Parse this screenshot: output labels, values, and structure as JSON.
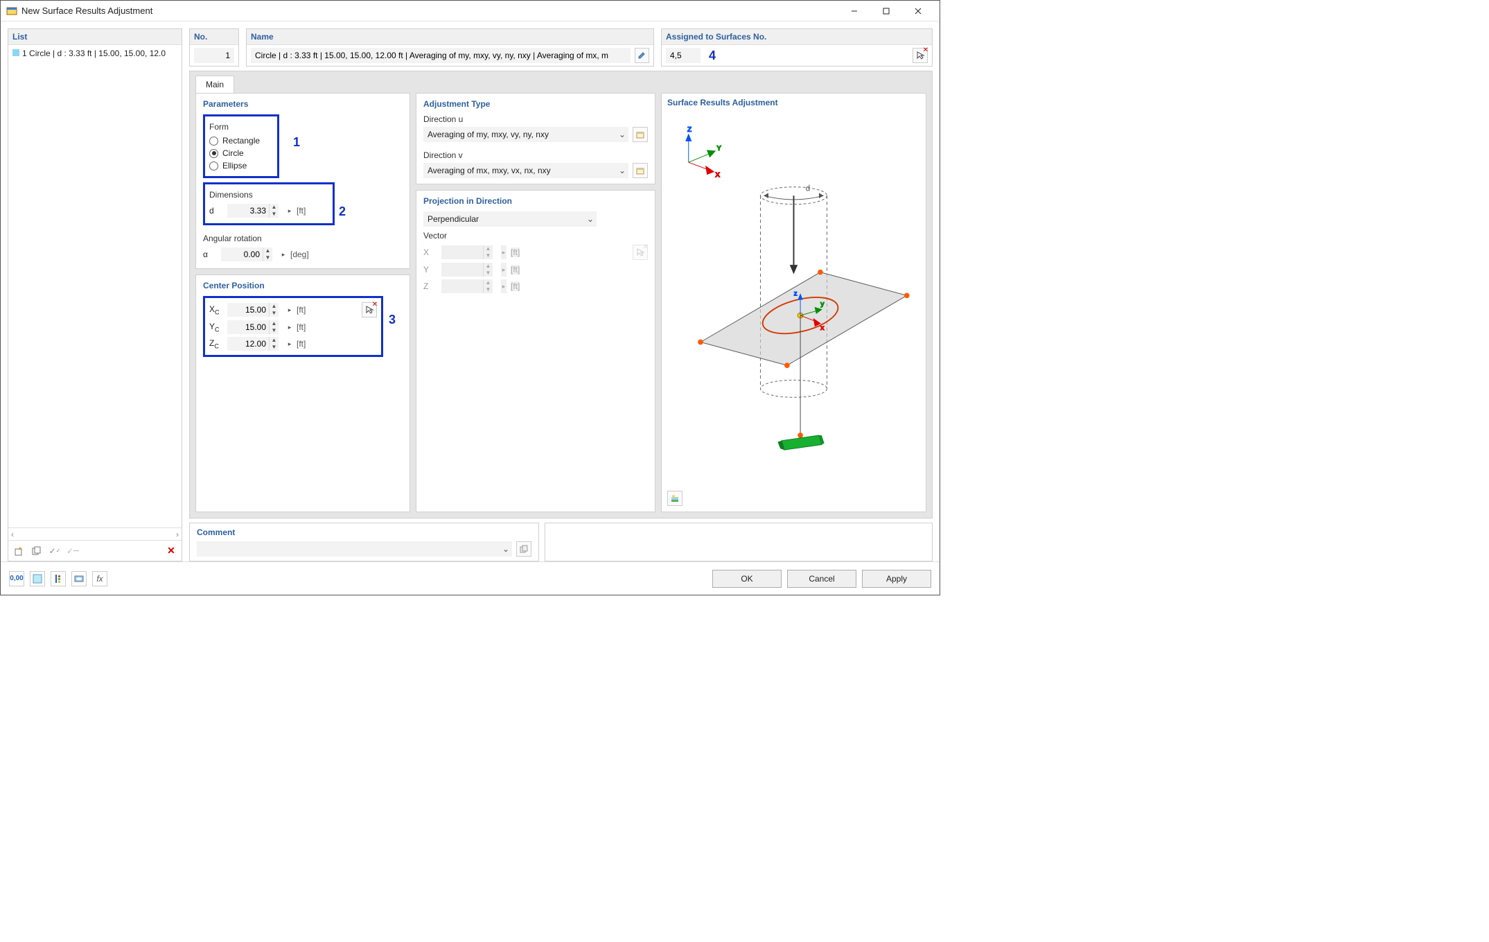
{
  "window": {
    "title": "New Surface Results Adjustment"
  },
  "list": {
    "header": "List",
    "items": [
      {
        "index": "1",
        "text": "Circle | d : 3.33 ft | 15.00, 15.00, 12.0"
      }
    ]
  },
  "headerRow": {
    "no": {
      "label": "No.",
      "value": "1"
    },
    "name": {
      "label": "Name",
      "value": "Circle | d : 3.33 ft | 15.00, 15.00, 12.00 ft | Averaging of my, mxy, vy, ny, nxy | Averaging of mx, m"
    },
    "assigned": {
      "label": "Assigned to Surfaces No.",
      "value": "4,5"
    }
  },
  "annotations": {
    "form": "1",
    "dimensions": "2",
    "center": "3",
    "assigned": "4"
  },
  "tabs": {
    "main": "Main"
  },
  "parameters": {
    "title": "Parameters",
    "form": {
      "label": "Form",
      "rectangle": "Rectangle",
      "circle": "Circle",
      "ellipse": "Ellipse",
      "selected": "circle"
    },
    "dimensions": {
      "label": "Dimensions",
      "d_label": "d",
      "d_value": "3.33",
      "d_unit": "[ft]"
    },
    "rotation": {
      "label": "Angular rotation",
      "a_label": "α",
      "a_value": "0.00",
      "a_unit": "[deg]"
    }
  },
  "center": {
    "title": "Center Position",
    "xc_label": "Xc",
    "xc_value": "15.00",
    "xc_unit": "[ft]",
    "yc_label": "Yc",
    "yc_value": "15.00",
    "yc_unit": "[ft]",
    "zc_label": "Zc",
    "zc_value": "12.00",
    "zc_unit": "[ft]"
  },
  "adj": {
    "title": "Adjustment Type",
    "u_label": "Direction u",
    "u_value": "Averaging of my, mxy, vy, ny, nxy",
    "v_label": "Direction v",
    "v_value": "Averaging of mx, mxy, vx, nx, nxy"
  },
  "proj": {
    "title": "Projection in Direction",
    "value": "Perpendicular",
    "vector": {
      "label": "Vector",
      "x_label": "X",
      "y_label": "Y",
      "z_label": "Z",
      "unit": "[ft]"
    }
  },
  "preview": {
    "title": "Surface Results Adjustment",
    "axes": {
      "z": "Z",
      "y": "Y",
      "x": "X",
      "sz": "z",
      "sy": "y",
      "sx": "x"
    },
    "d": "d"
  },
  "comment": {
    "title": "Comment"
  },
  "buttons": {
    "ok": "OK",
    "cancel": "Cancel",
    "apply": "Apply"
  }
}
